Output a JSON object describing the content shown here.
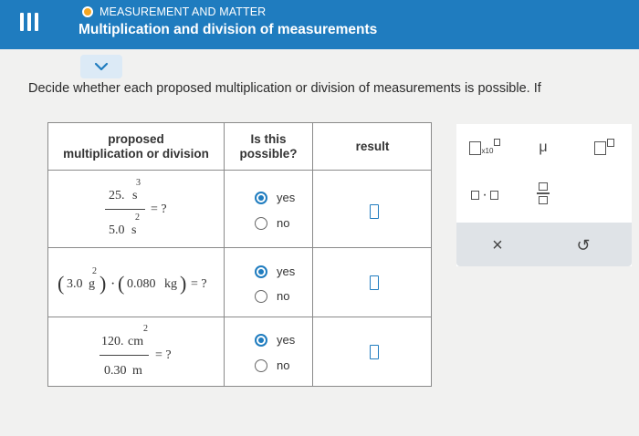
{
  "header": {
    "topic": "MEASUREMENT AND MATTER",
    "title": "Multiplication and division of measurements"
  },
  "prompt": "Decide whether each proposed multiplication or division of measurements is possible. If",
  "table": {
    "columns": [
      "proposed",
      "multiplication or division",
      "Is this",
      "possible?",
      "result"
    ],
    "rows": [
      {
        "num_value": "25.",
        "num_unit": "s",
        "num_exp": "3",
        "den_value": "5.0",
        "den_unit": "s",
        "den_exp": "2",
        "rhs": "= ?",
        "options": [
          "yes",
          "no"
        ],
        "selected": "yes"
      },
      {
        "open1": "(",
        "v1": "3.0",
        "u1": "g",
        "e1": "2",
        "close1": ")",
        "dot": "·",
        "open2": "(",
        "v2": "0.080",
        "u2": "kg",
        "close2": ")",
        "rhs": "= ?",
        "options": [
          "yes",
          "no"
        ],
        "selected": "yes"
      },
      {
        "num_value": "120.",
        "num_unit": "cm",
        "num_exp": "2",
        "den_value": "0.30",
        "den_unit": "m",
        "rhs": "= ?",
        "options": [
          "yes",
          "no"
        ],
        "selected": "yes"
      }
    ]
  },
  "palette": {
    "sci_label": "x10",
    "mu": "μ",
    "times_dot": "·",
    "clear": "×",
    "undo": "↺"
  },
  "colors": {
    "topbar": "#1f7cbf",
    "accent": "#1f7cbf",
    "topic_dot": "#f5a623"
  }
}
